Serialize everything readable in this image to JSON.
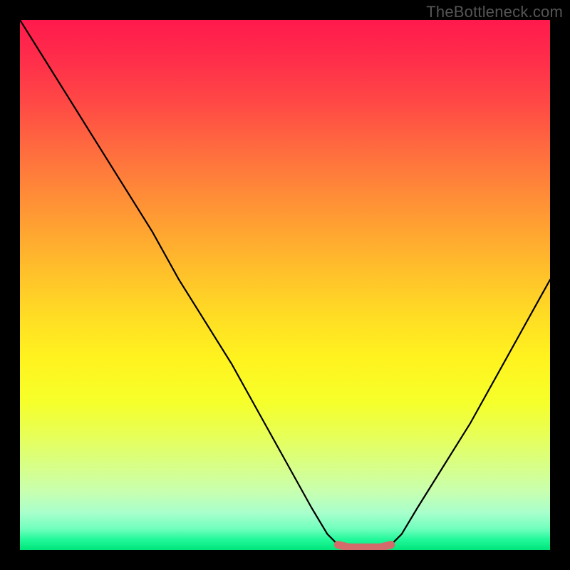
{
  "watermark": "TheBottleneck.com",
  "chart_data": {
    "type": "line",
    "title": "",
    "xlabel": "",
    "ylabel": "",
    "xlim": [
      0,
      100
    ],
    "ylim": [
      0,
      100
    ],
    "series": [
      {
        "name": "bottleneck-curve",
        "x": [
          0,
          5,
          10,
          15,
          20,
          25,
          30,
          35,
          40,
          45,
          50,
          55,
          58,
          60,
          62,
          65,
          68,
          70,
          72,
          75,
          80,
          85,
          90,
          95,
          100
        ],
        "y": [
          100,
          92,
          84,
          76,
          68,
          60,
          51,
          43,
          35,
          26,
          17,
          8,
          3,
          1,
          0.5,
          0.5,
          0.5,
          1,
          3,
          8,
          16,
          24,
          33,
          42,
          51
        ]
      }
    ],
    "highlight": {
      "name": "optimal-range",
      "x_start": 60,
      "x_end": 70,
      "color": "#d46a6a"
    },
    "gradient_stops": [
      {
        "pos": 0,
        "color": "#ff1a4d"
      },
      {
        "pos": 50,
        "color": "#ffdd24"
      },
      {
        "pos": 100,
        "color": "#00e57a"
      }
    ]
  }
}
